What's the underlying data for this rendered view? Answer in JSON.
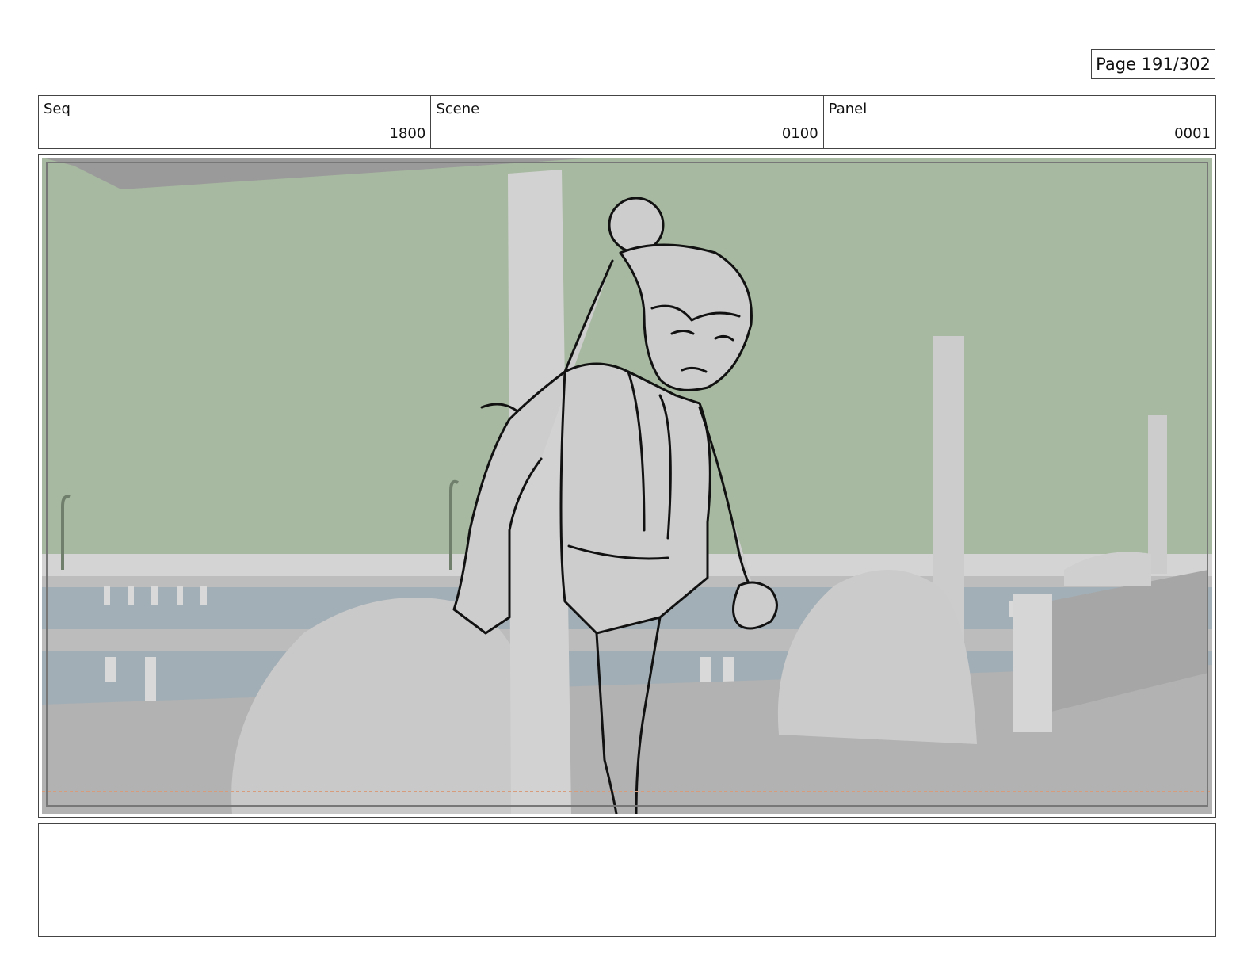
{
  "page": {
    "label": "Page 191/302"
  },
  "header": {
    "seq": {
      "label": "Seq",
      "value": "1800"
    },
    "scene": {
      "label": "Scene",
      "value": "0100"
    },
    "panel": {
      "label": "Panel",
      "value": "0001"
    }
  },
  "colors": {
    "sky": "#a7b9a0",
    "water": "#a3afb6",
    "ground": "#b2b2b2",
    "props": "#cccccc",
    "line": "#111111"
  },
  "notes": {
    "text": ""
  }
}
